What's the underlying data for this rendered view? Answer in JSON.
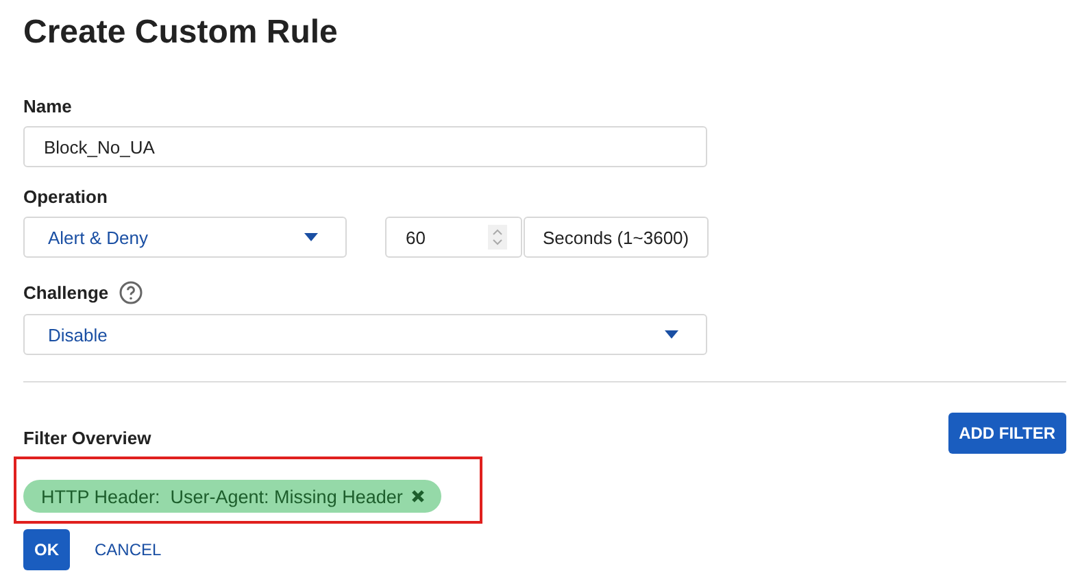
{
  "title": "Create Custom Rule",
  "name_field": {
    "label": "Name",
    "value": "Block_No_UA"
  },
  "operation": {
    "label": "Operation",
    "value": "Alert & Deny",
    "duration": "60",
    "unit": "Seconds (1~3600)"
  },
  "challenge": {
    "label": "Challenge",
    "value": "Disable"
  },
  "filter_overview": {
    "label": "Filter Overview",
    "add_button": "ADD FILTER",
    "highlighted": true,
    "filters": [
      {
        "text": "HTTP Header:  User-Agent: Missing Header"
      }
    ]
  },
  "buttons": [
    {
      "label": "OK",
      "kind": "primary"
    },
    {
      "label": "CANCEL",
      "kind": "text"
    }
  ]
}
